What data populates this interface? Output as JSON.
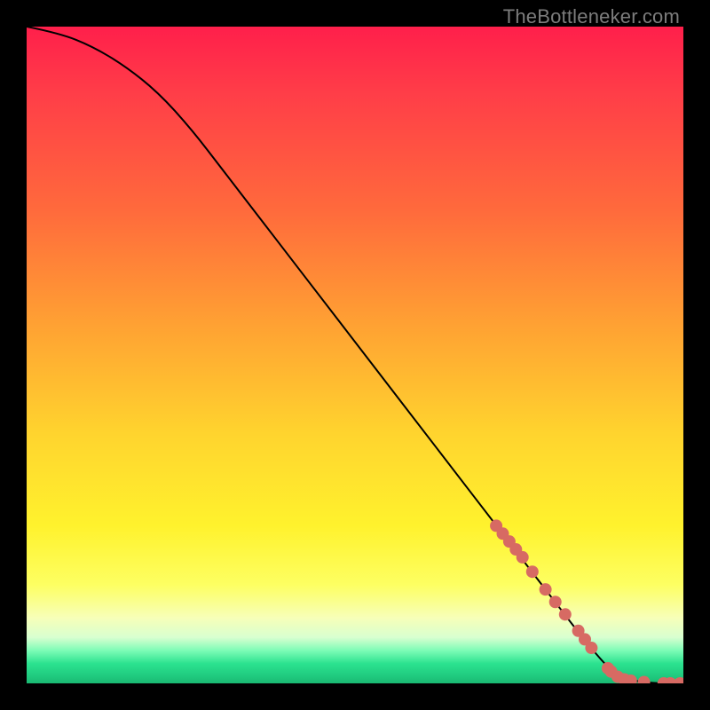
{
  "meta": {
    "watermark": "TheBottleneker.com"
  },
  "chart_data": {
    "type": "line",
    "title": "",
    "xlabel": "",
    "ylabel": "",
    "xlim": [
      0,
      100
    ],
    "ylim": [
      0,
      100
    ],
    "grid": false,
    "series": [
      {
        "name": "curve",
        "x": [
          0,
          5,
          10,
          15,
          20,
          25,
          30,
          35,
          40,
          45,
          50,
          55,
          60,
          65,
          70,
          75,
          80,
          85,
          88,
          90,
          93,
          96,
          100
        ],
        "y": [
          100,
          99,
          97,
          94,
          90,
          84.5,
          78,
          71.5,
          65,
          58.5,
          52,
          45.5,
          39,
          32.5,
          26,
          19.5,
          13,
          6.5,
          3,
          1,
          0.3,
          0,
          0
        ]
      }
    ],
    "markers": [
      {
        "name": "cluster-a",
        "x": 71.5,
        "y": 24.0
      },
      {
        "name": "cluster-a",
        "x": 72.5,
        "y": 22.8
      },
      {
        "name": "cluster-a",
        "x": 73.5,
        "y": 21.6
      },
      {
        "name": "cluster-a",
        "x": 74.5,
        "y": 20.4
      },
      {
        "name": "cluster-a",
        "x": 75.5,
        "y": 19.2
      },
      {
        "name": "cluster-a",
        "x": 77.0,
        "y": 17.0
      },
      {
        "name": "cluster-b",
        "x": 79.0,
        "y": 14.3
      },
      {
        "name": "cluster-b",
        "x": 80.5,
        "y": 12.4
      },
      {
        "name": "cluster-b",
        "x": 82.0,
        "y": 10.5
      },
      {
        "name": "cluster-c",
        "x": 84.0,
        "y": 8.0
      },
      {
        "name": "cluster-c",
        "x": 85.0,
        "y": 6.7
      },
      {
        "name": "cluster-c",
        "x": 86.0,
        "y": 5.4
      },
      {
        "name": "cluster-d",
        "x": 88.5,
        "y": 2.3
      },
      {
        "name": "cluster-d",
        "x": 89.0,
        "y": 1.8
      },
      {
        "name": "baseline",
        "x": 90.0,
        "y": 1.0
      },
      {
        "name": "baseline",
        "x": 91.0,
        "y": 0.6
      },
      {
        "name": "baseline",
        "x": 92.0,
        "y": 0.4
      },
      {
        "name": "baseline",
        "x": 94.0,
        "y": 0.2
      },
      {
        "name": "baseline",
        "x": 97.0,
        "y": 0.0
      },
      {
        "name": "baseline",
        "x": 98.0,
        "y": 0.0
      },
      {
        "name": "baseline",
        "x": 99.5,
        "y": 0.0
      }
    ],
    "marker_color": "#d76a63",
    "curve_color": "#000000"
  }
}
